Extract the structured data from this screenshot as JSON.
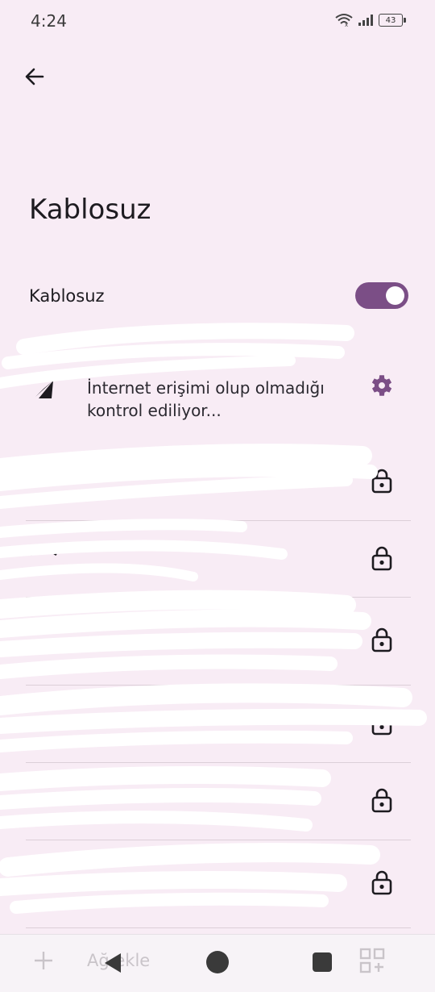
{
  "status_bar": {
    "time": "4:24",
    "battery": "43"
  },
  "header": {
    "title": "Kablosuz"
  },
  "wifi_toggle": {
    "label": "Kablosuz",
    "on": true
  },
  "current_network": {
    "status": "İnternet erişimi olup olmadığı kontrol ediliyor..."
  },
  "nav": {
    "add_label": "Ağ ekle"
  },
  "colors": {
    "background": "#f8ecf5",
    "accent": "#7b4e86"
  }
}
